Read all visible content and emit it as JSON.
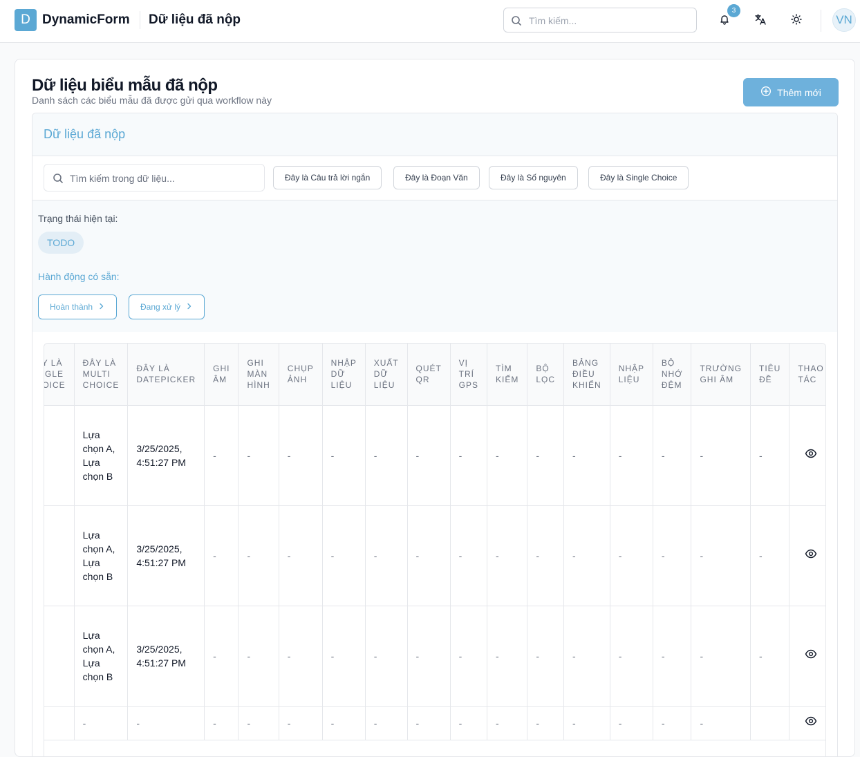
{
  "header": {
    "logo_letter": "D",
    "app_name": "DynamicForm",
    "page_title": "Dữ liệu đã nộp",
    "search_placeholder": "Tìm kiếm...",
    "notification_count": "3",
    "avatar": "VN"
  },
  "main": {
    "title": "Dữ liệu biểu mẫu đã nộp",
    "subtitle": "Danh sách các biểu mẫu đã được gửi qua workflow này",
    "add_button": "Thêm mới",
    "panel_title": "Dữ liệu đã nộp",
    "data_search_placeholder": "Tìm kiếm trong dữ liệu...",
    "filter_chips": [
      "Đây là Câu trả lời ngắn",
      "Đây là Đoạn Văn",
      "Đây là Số nguyên",
      "Đây là Single Choice"
    ],
    "status_label": "Trạng thái hiện tại:",
    "status_value": "TODO",
    "actions_label": "Hành động có sẵn:",
    "actions": [
      "Hoàn thành",
      "Đang xử lý"
    ]
  },
  "table": {
    "columns": [
      "Đây là Single Choice",
      "Đây là Multi Choice",
      "Đây là Datepicker",
      "Ghi âm",
      "Ghi màn hình",
      "Chụp ảnh",
      "Nhập dữ liệu",
      "Xuất dữ liệu",
      "Quét QR",
      "Vị trí GPS",
      "Tìm kiếm",
      "Bộ lọc",
      "Bảng điều khiển",
      "Nhập liệu",
      "Bộ nhớ đệm",
      "Trường ghi âm",
      "Tiêu đề",
      "Thao tác"
    ],
    "rows": [
      [
        "-",
        "Lựa chọn A, Lựa chọn B",
        "3/25/2025, 4:51:27 PM",
        "-",
        "-",
        "-",
        "-",
        "-",
        "-",
        "-",
        "-",
        "-",
        "-",
        "-",
        "-",
        "-",
        "-",
        ""
      ],
      [
        "-",
        "Lựa chọn A, Lựa chọn B",
        "3/25/2025, 4:51:27 PM",
        "-",
        "-",
        "-",
        "-",
        "-",
        "-",
        "-",
        "-",
        "-",
        "-",
        "-",
        "-",
        "-",
        "-",
        ""
      ],
      [
        "-",
        "Lựa chọn A, Lựa chọn B",
        "3/25/2025, 4:51:27 PM",
        "-",
        "-",
        "-",
        "-",
        "-",
        "-",
        "-",
        "-",
        "-",
        "-",
        "-",
        "-",
        "-",
        "-",
        ""
      ],
      [
        "-",
        "-",
        "-",
        "-",
        "-",
        "-",
        "-",
        "-",
        "-",
        "-",
        "-",
        "-",
        "-",
        "-",
        "-",
        "-",
        "",
        ""
      ]
    ]
  },
  "colors": {
    "accent": "#5ba8d4",
    "accent_button": "#6eb1dc",
    "panel_bg": "#f7fafc",
    "border": "#e5e7eb"
  },
  "icons": [
    "search-icon",
    "bell-icon",
    "translate-icon",
    "sun-icon",
    "plus-circle-icon",
    "chevron-right-icon",
    "eye-icon"
  ]
}
